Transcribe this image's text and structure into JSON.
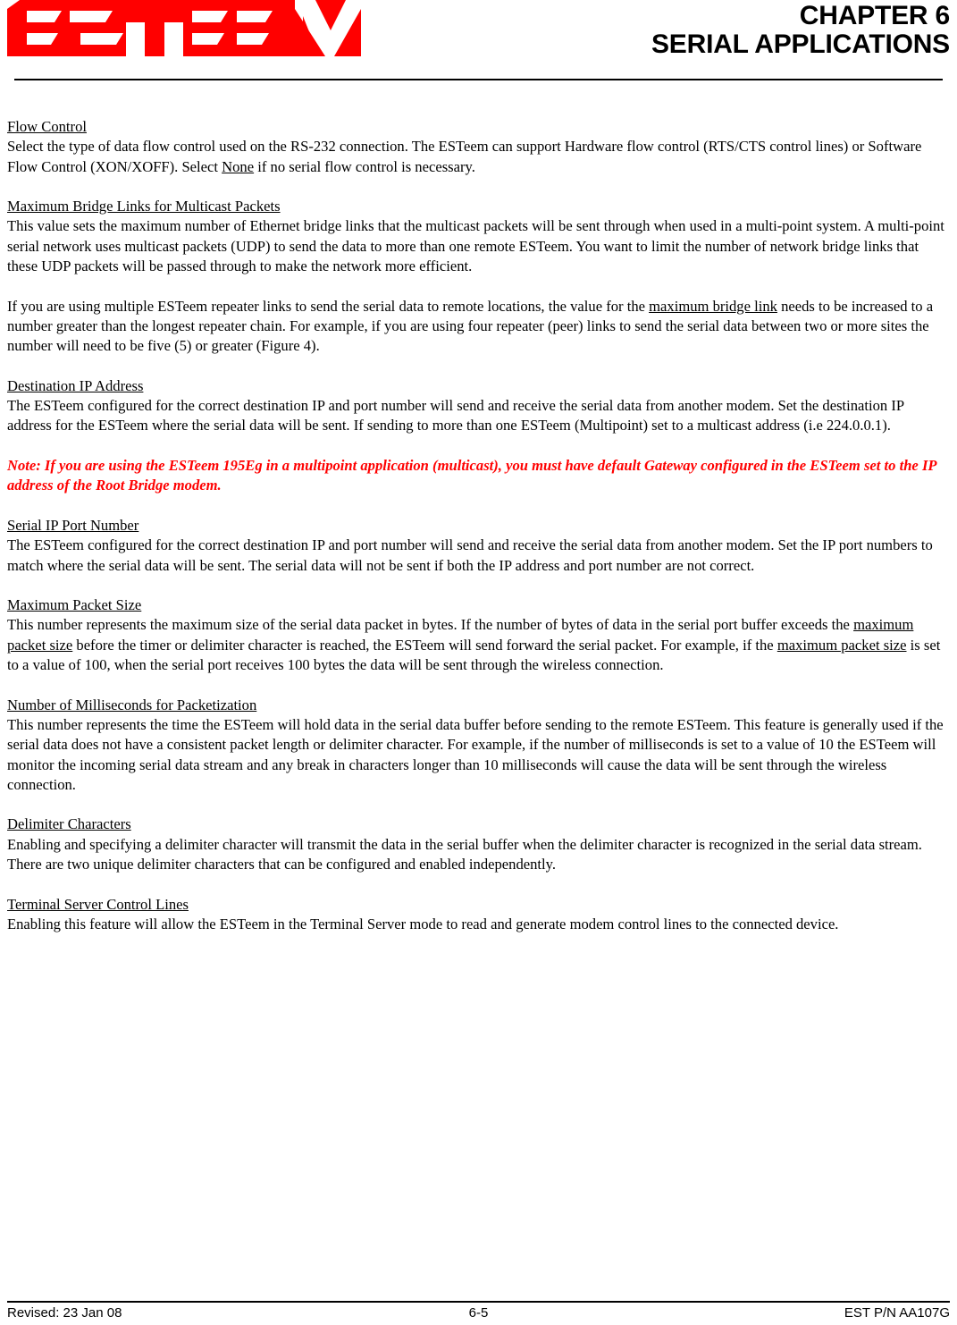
{
  "header": {
    "logo_text": "ESTEEM",
    "logo_color": "#ff0000",
    "chapter_line_1": "CHAPTER 6",
    "chapter_line_2": "SERIAL APPLICATIONS"
  },
  "body": {
    "sections": [
      {
        "heading": "Flow Control",
        "paragraphs": [
          "Select the type of data flow control used on the RS-232 connection. The ESTeem can support Hardware flow control (RTS/CTS control lines) or Software Flow Control (XON/XOFF). Select None if no serial flow control is necessary."
        ]
      },
      {
        "heading": "Maximum Bridge Links for Multicast Packets",
        "paragraphs": [
          "This value sets the maximum number of Ethernet bridge links that the multicast packets will be sent through when used in a multi-point system. A multi-point serial network uses multicast packets (UDP) to send the data to more than one remote ESTeem. You want to limit the number of network bridge links that these UDP packets will be passed through to make the network more efficient.",
          "If you are using multiple ESTeem repeater links to send the serial data to remote locations, the value for the maximum bridge link needs to be increased to a number greater than the longest repeater chain. For example, if you are using four repeater (peer) links to send the serial data between two or more sites the number will need to be five (5) or greater (Figure 4)."
        ]
      },
      {
        "heading": "Destination IP Address",
        "paragraphs": [
          "The ESTeem configured for the correct destination IP and port number will send and receive the serial data from another modem. Set the destination IP address for the ESTeem where the serial data will be sent.  If sending to more than one ESTeem (Multipoint) set to a multicast address (i.e 224.0.0.1)."
        ]
      },
      {
        "heading": "Serial IP Port Number",
        "paragraphs": [
          "The ESTeem configured for the correct destination IP and port number will send and receive the serial data from another modem. Set the IP port numbers to match where the serial data will be sent. The serial data will not be sent if both the IP address and port number are not correct."
        ]
      },
      {
        "heading": "Maximum Packet Size",
        "paragraphs": [
          "This number represents the maximum size of the serial data packet in bytes. If the number of bytes of data in the serial port buffer exceeds the maximum packet size before the timer or delimiter character is reached, the ESTeem will send forward the serial packet. For example, if the maximum packet size is set to a value of 100, when the serial port receives 100 bytes the data will be sent through the wireless connection."
        ]
      },
      {
        "heading": "Number of Milliseconds for Packetization",
        "paragraphs": [
          "This number represents the time the ESTeem will hold data in the serial data buffer before sending to the remote ESTeem. This feature is generally used if the serial data does not have a consistent packet length or delimiter character. For example, if the number of milliseconds is set to a value of 10 the ESTeem will monitor the incoming serial data stream and any break in characters longer than 10 milliseconds will cause the data will be sent through the wireless connection."
        ]
      },
      {
        "heading": "Delimiter Characters",
        "paragraphs": [
          "Enabling and specifying a delimiter character will transmit the data in the serial buffer when the delimiter character is recognized in the serial data stream. There are two unique delimiter characters that can be configured and enabled independently."
        ]
      },
      {
        "heading": "Terminal Server Control Lines",
        "paragraphs": [
          "Enabling this feature will allow the ESTeem in the Terminal Server mode to read and generate modem control lines to the connected device."
        ]
      }
    ],
    "flow_control": {
      "part_1": "Select the type of data flow control used on the RS-232 connection. The ESTeem can support Hardware flow control (RTS/CTS control lines) or Software Flow Control (XON/XOFF). Select ",
      "emphasis": "None",
      "part_2": " if no serial flow control is necessary."
    },
    "bridge_links_2": {
      "part_1": "If you are using multiple ESTeem repeater links to send the serial data to remote locations, the value for the ",
      "emphasis": "maximum bridge link",
      "part_2": " needs to be increased to a number greater than the longest repeater chain. For example, if you are using four repeater (peer) links to send the serial data between two or more sites the number will need to be five (5) or greater (Figure 4)."
    },
    "packet_size": {
      "part_1": "This number represents the maximum size of the serial data packet in bytes. If the number of bytes of data in the serial port buffer exceeds the ",
      "emphasis_1": "maximum packet size",
      "part_2": " before the timer or delimiter character is reached, the ESTeem will send forward the serial packet. For example, if the ",
      "emphasis_2": "maximum packet size",
      "part_3": " is set to a value of 100, when the serial port receives 100 bytes the data will be sent through the wireless connection."
    },
    "note": "Note: If you are using the ESTeem 195Eg in a multipoint application (multicast), you must have default Gateway configured in the ESTeem set to the IP address of the Root Bridge modem."
  },
  "footer": {
    "revised": "Revised: 23 Jan 08",
    "page_number": "6-5",
    "part_number": "EST P/N AA107G"
  }
}
